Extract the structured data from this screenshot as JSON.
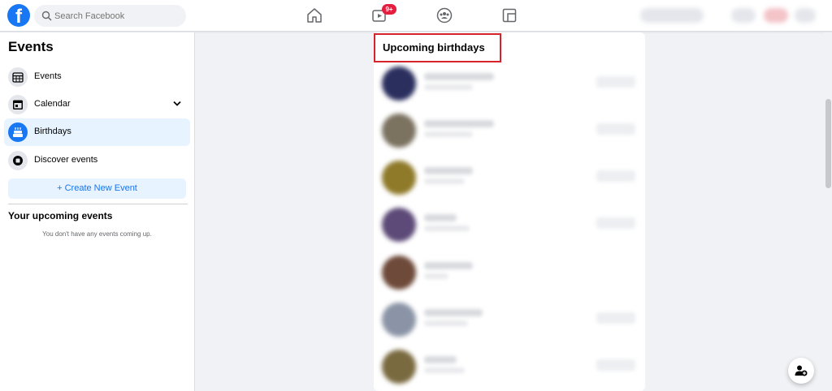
{
  "header": {
    "search_placeholder": "Search Facebook",
    "watch_badge": "9+"
  },
  "sidebar": {
    "title": "Events",
    "items": [
      {
        "label": "Events",
        "icon": "calendar-grid-icon"
      },
      {
        "label": "Calendar",
        "icon": "calendar-icon"
      },
      {
        "label": "Birthdays",
        "icon": "birthday-cake-icon",
        "active": true
      },
      {
        "label": "Discover events",
        "icon": "discover-icon"
      }
    ],
    "create_button": "+ Create New Event",
    "upcoming_title": "Your upcoming events",
    "upcoming_empty": "You don't have any events coming up."
  },
  "main": {
    "title": "Upcoming birthdays"
  },
  "colors": {
    "brand": "#1877f2",
    "highlight_box": "#d5222b",
    "badge": "#e41e3f"
  }
}
